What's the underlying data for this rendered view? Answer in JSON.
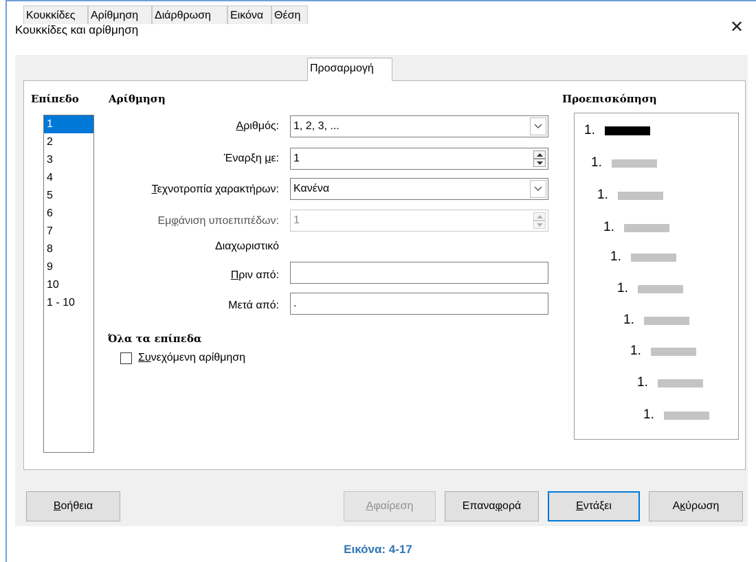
{
  "window": {
    "title": "Κουκκίδες και αρίθμηση"
  },
  "tabs": [
    {
      "label": "Κουκκίδες"
    },
    {
      "label": "Αρίθμηση"
    },
    {
      "label": "Διάρθρωση"
    },
    {
      "label": "Εικόνα"
    },
    {
      "label": "Θέση"
    },
    {
      "label": "Προσαρμογή",
      "active": true
    }
  ],
  "level": {
    "header": "Επίπεδο",
    "items": [
      "1",
      "2",
      "3",
      "4",
      "5",
      "6",
      "7",
      "8",
      "9",
      "10",
      "1 - 10"
    ],
    "selected": "1"
  },
  "numbering": {
    "header": "Αρίθμηση",
    "number_label": "Αριθμός:",
    "number_value": "1, 2, 3, ...",
    "start_label": "Έναρξη με:",
    "start_value": "1",
    "charstyle_label": "Τεχνοτροπία χαρακτήρων:",
    "charstyle_value": "Κανένα",
    "sublevels_label": "Εμφάνιση υποεπιπέδων:",
    "sublevels_value": "1",
    "separator_label": "Διαχωριστικό",
    "before_label": "Πριν από:",
    "before_value": "",
    "after_label": "Μετά από:",
    "after_value": "."
  },
  "all_levels": {
    "header": "Όλα τα επίπεδα",
    "consecutive_label": "Συνεχόμενη αρίθμηση",
    "consecutive_checked": false
  },
  "preview": {
    "header": "Προεπισκόπηση",
    "items": [
      "1.",
      "1.",
      "1.",
      "1.",
      "1.",
      "1.",
      "1.",
      "1.",
      "1.",
      "1."
    ]
  },
  "buttons": {
    "help": "Βοήθεια",
    "remove": "Αφαίρεση",
    "reset": "Επαναφορά",
    "ok": "Εντάξει",
    "cancel": "Ακύρωση"
  },
  "caption": {
    "text": "Εικόνα: 4-17",
    "color": "#2f75b5"
  },
  "colors": {
    "accent": "#0078d7",
    "frame": "#6f9fd8"
  }
}
